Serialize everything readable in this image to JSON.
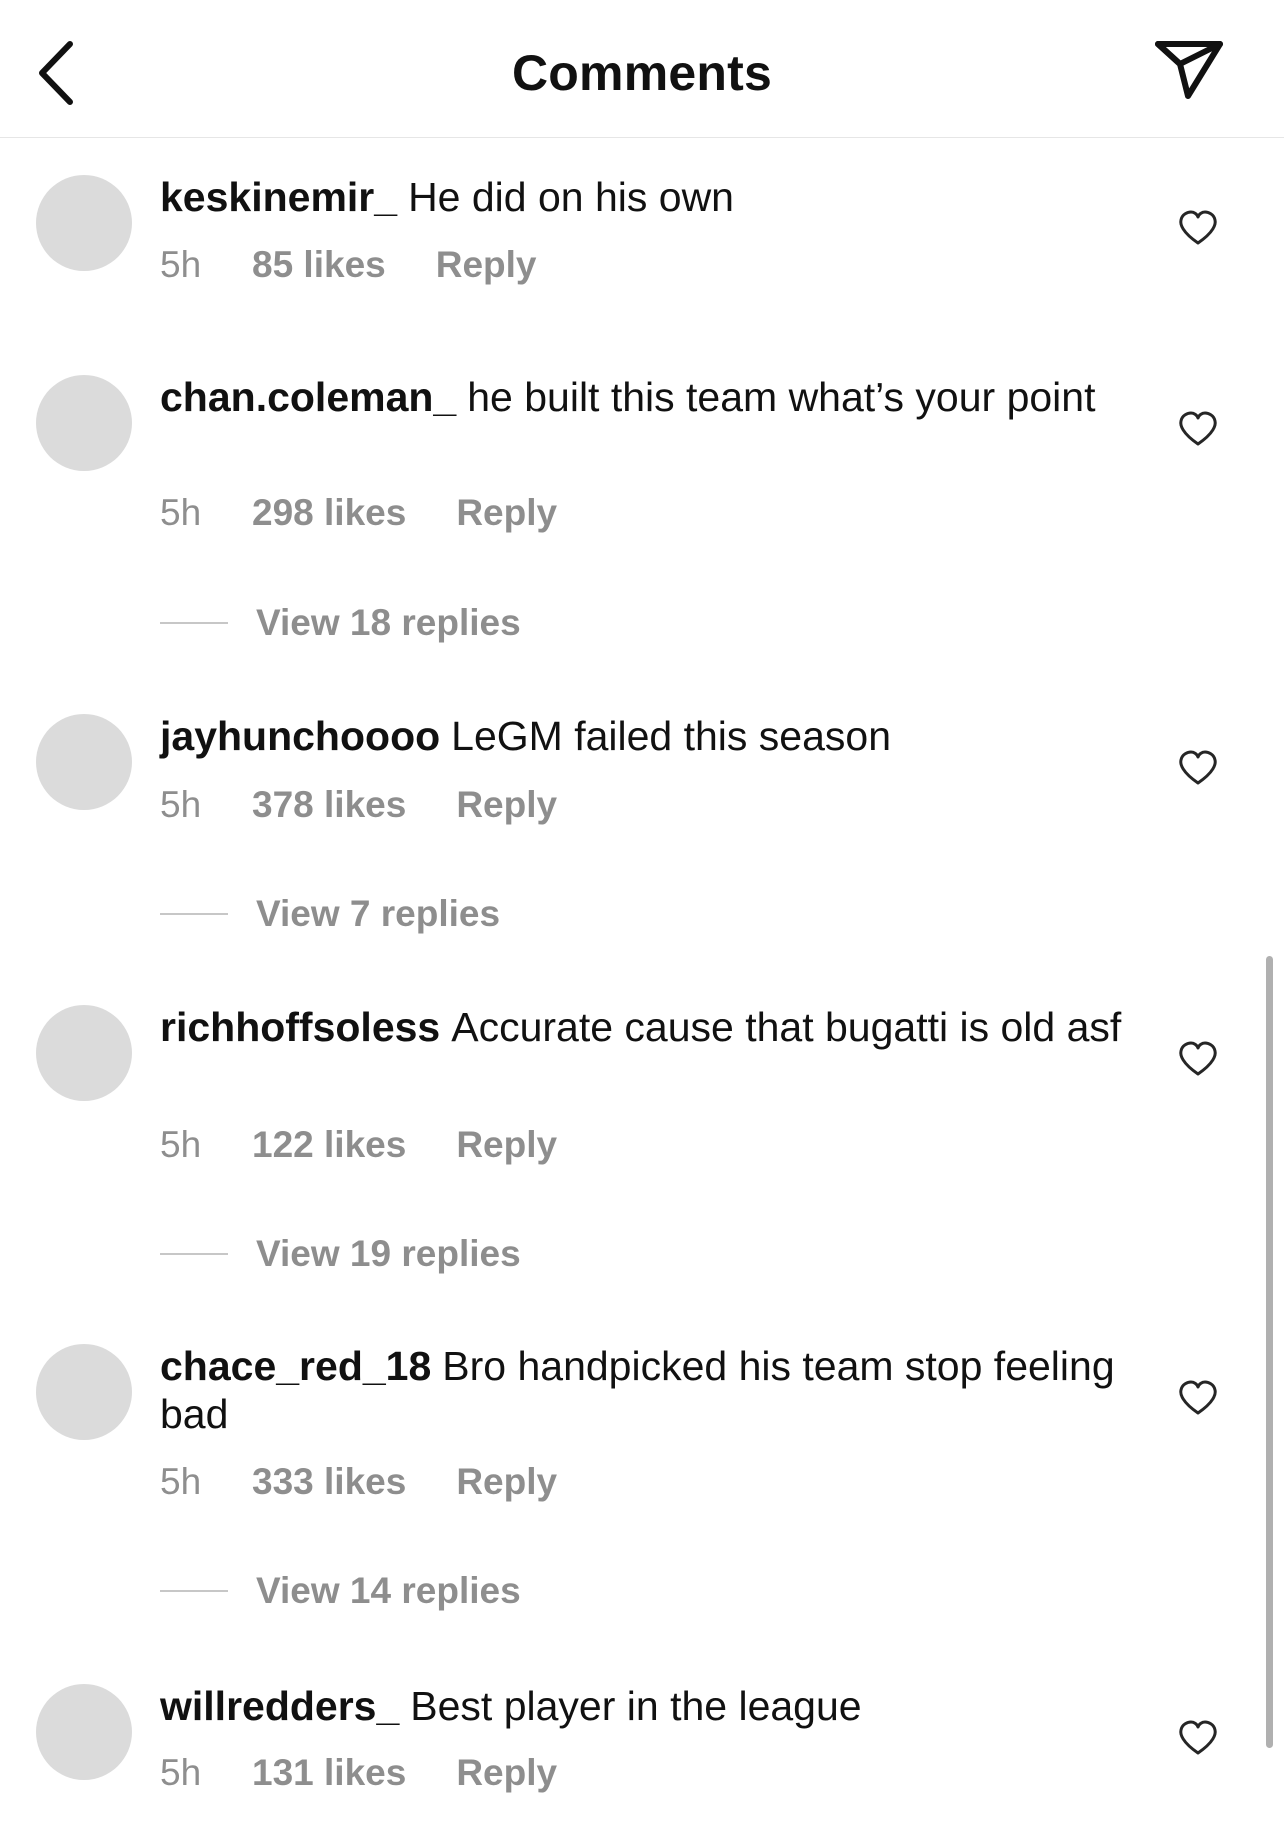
{
  "header": {
    "title": "Comments",
    "back_icon": "chevron-left-icon",
    "send_icon": "paper-plane-icon"
  },
  "comments": [
    {
      "username": "keskinemir_",
      "text": "He did on his own",
      "time": "5h",
      "likes": "85 likes",
      "reply": "Reply"
    },
    {
      "username": "chan.coleman_",
      "text": "he built this team what’s your point",
      "time": "5h",
      "likes": "298 likes",
      "reply": "Reply",
      "view_replies": "View 18 replies"
    },
    {
      "username": "jayhunchoooo",
      "text": "LeGM failed this season",
      "time": "5h",
      "likes": "378 likes",
      "reply": "Reply",
      "view_replies": "View 7 replies"
    },
    {
      "username": "richhoffsoless",
      "text": "Accurate cause that bugatti is old asf",
      "time": "5h",
      "likes": "122 likes",
      "reply": "Reply",
      "view_replies": "View 19 replies"
    },
    {
      "username": "chace_red_18",
      "text": "Bro handpicked his team stop feeling bad",
      "time": "5h",
      "likes": "333 likes",
      "reply": "Reply",
      "view_replies": "View 14 replies"
    },
    {
      "username": "willredders_",
      "text": "Best player in the league",
      "time": "5h",
      "likes": "131 likes",
      "reply": "Reply"
    }
  ],
  "colors": {
    "secondary_text": "#8e8e8e",
    "avatar_placeholder": "#dbdbdb"
  }
}
